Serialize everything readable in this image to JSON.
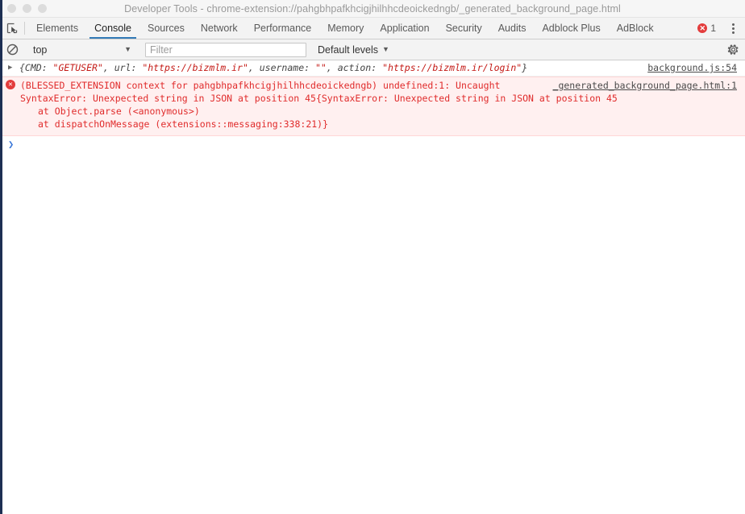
{
  "window": {
    "title": "Developer Tools - chrome-extension://pahgbhpafkhcigjhilhhcdeoickedngb/_generated_background_page.html",
    "traffic_lights": [
      "close",
      "minimize",
      "zoom"
    ]
  },
  "tab_bar": {
    "inspect_icon": "inspect-element-icon",
    "tabs": [
      {
        "label": "Elements",
        "active": false
      },
      {
        "label": "Console",
        "active": true
      },
      {
        "label": "Sources",
        "active": false
      },
      {
        "label": "Network",
        "active": false
      },
      {
        "label": "Performance",
        "active": false
      },
      {
        "label": "Memory",
        "active": false
      },
      {
        "label": "Application",
        "active": false
      },
      {
        "label": "Security",
        "active": false
      },
      {
        "label": "Audits",
        "active": false
      },
      {
        "label": "Adblock Plus",
        "active": false
      },
      {
        "label": "AdBlock",
        "active": false
      }
    ],
    "error_badge": {
      "icon": "error-circle-icon",
      "glyph": "✕",
      "count": "1",
      "color": "#e33c3c"
    },
    "more_menu_icon": "kebab-menu-icon",
    "active_tab_underline_color": "#337ab7"
  },
  "console_toolbar": {
    "clear_icon": "clear-console-icon",
    "context": {
      "value": "top",
      "caret": "▼"
    },
    "filter": {
      "value": "",
      "placeholder": "Filter"
    },
    "levels": {
      "value": "Default levels",
      "caret": "▼"
    },
    "settings_icon": "gear-icon"
  },
  "console": {
    "messages": [
      {
        "kind": "log",
        "disclosure": "▶",
        "source_link": "background.js:54",
        "segments": [
          {
            "text": "{CMD: ",
            "type": "plain"
          },
          {
            "text": "\"GETUSER\"",
            "type": "string"
          },
          {
            "text": ", url: ",
            "type": "plain"
          },
          {
            "text": "\"https://bizmlm.ir\"",
            "type": "string"
          },
          {
            "text": ", username: ",
            "type": "plain"
          },
          {
            "text": "\"\"",
            "type": "string"
          },
          {
            "text": ", action: ",
            "type": "plain"
          },
          {
            "text": "\"https://bizmlm.ir/login\"",
            "type": "string"
          },
          {
            "text": "}",
            "type": "plain"
          }
        ]
      },
      {
        "kind": "error",
        "icon": "error-circle-icon",
        "glyph": "✕",
        "source_link": "_generated_background_page.html:1",
        "line1": "(BLESSED_EXTENSION context for pahgbhpafkhcigjhilhhcdeoickedngb) undefined:1: Uncaught",
        "line2": "SyntaxError: Unexpected string in JSON at position 45{SyntaxError: Unexpected string in JSON at position 45",
        "stack": [
          "at Object.parse (<anonymous>)",
          "at dispatchOnMessage (extensions::messaging:338:21)}"
        ]
      }
    ],
    "prompt": {
      "caret": "❯",
      "value": ""
    }
  },
  "colors": {
    "accent": "#337ab7",
    "error": "#e33c3c",
    "error_text": "#e02b2b",
    "error_bg": "#fff0f0",
    "string_literal": "#c41a16",
    "prompt": "#3a77d8",
    "left_strip": "#1d2f53"
  }
}
